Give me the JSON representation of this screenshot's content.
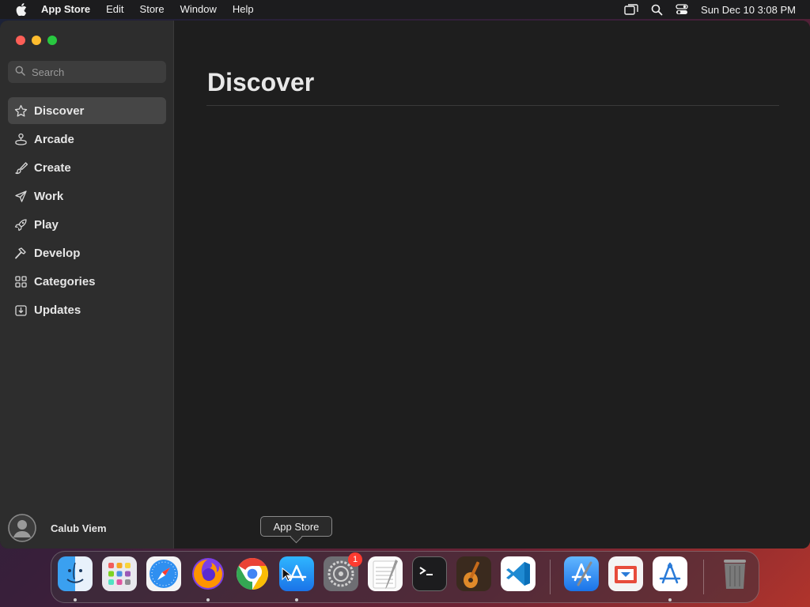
{
  "menubar": {
    "app_name": "App Store",
    "menus": [
      "Edit",
      "Store",
      "Window",
      "Help"
    ],
    "clock": "Sun Dec 10  3:08 PM"
  },
  "sidebar": {
    "search_placeholder": "Search",
    "items": [
      {
        "label": "Discover",
        "icon": "star-icon",
        "active": true
      },
      {
        "label": "Arcade",
        "icon": "joystick-icon"
      },
      {
        "label": "Create",
        "icon": "brush-icon"
      },
      {
        "label": "Work",
        "icon": "paper-plane-icon"
      },
      {
        "label": "Play",
        "icon": "rocket-icon"
      },
      {
        "label": "Develop",
        "icon": "hammer-icon"
      },
      {
        "label": "Categories",
        "icon": "grid-icon"
      },
      {
        "label": "Updates",
        "icon": "download-icon"
      }
    ],
    "user_name": "Calub Viem"
  },
  "main": {
    "title": "Discover"
  },
  "tooltip": {
    "text": "App Store"
  },
  "dock": {
    "badge_count": "1"
  },
  "colors": {
    "close": "#fe5f57",
    "minimize": "#febc2e",
    "zoom": "#28c840",
    "badge": "#ff3b30"
  }
}
